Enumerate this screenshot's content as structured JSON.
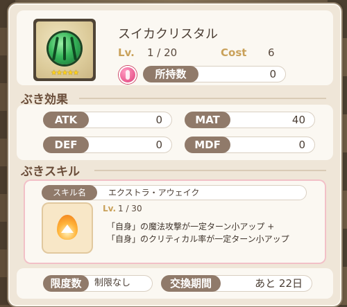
{
  "item": {
    "name": "スイカクリスタル",
    "stars": "★★★★★",
    "lv_label": "Lv.",
    "lv_value": "1 / 20",
    "cost_label": "Cost",
    "cost_value": "6",
    "owned_label": "所持数",
    "owned_value": "0"
  },
  "effects": {
    "title": "ぶき効果",
    "stats": [
      {
        "label": "ATK",
        "value": "0"
      },
      {
        "label": "MAT",
        "value": "40"
      },
      {
        "label": "DEF",
        "value": "0"
      },
      {
        "label": "MDF",
        "value": "0"
      }
    ]
  },
  "skill": {
    "title": "ぶきスキル",
    "name_label": "スキル名",
    "name_value": "エクストラ・アウェイク",
    "lv_label": "Lv.",
    "lv_value": "1 / 30",
    "desc": [
      "「自身」の魔法攻撃が一定ターン小アップ +",
      "「自身」のクリティカル率が一定ターン小アップ"
    ]
  },
  "footer": {
    "limit_label": "限度数",
    "limit_value": "制限なし",
    "exchange_label": "交換期間",
    "exchange_value": "あと 22日"
  },
  "colors": {
    "label_pill": "#907a6a",
    "accent_gold": "#c9a15a",
    "panel_bg": "#efe6d8"
  }
}
